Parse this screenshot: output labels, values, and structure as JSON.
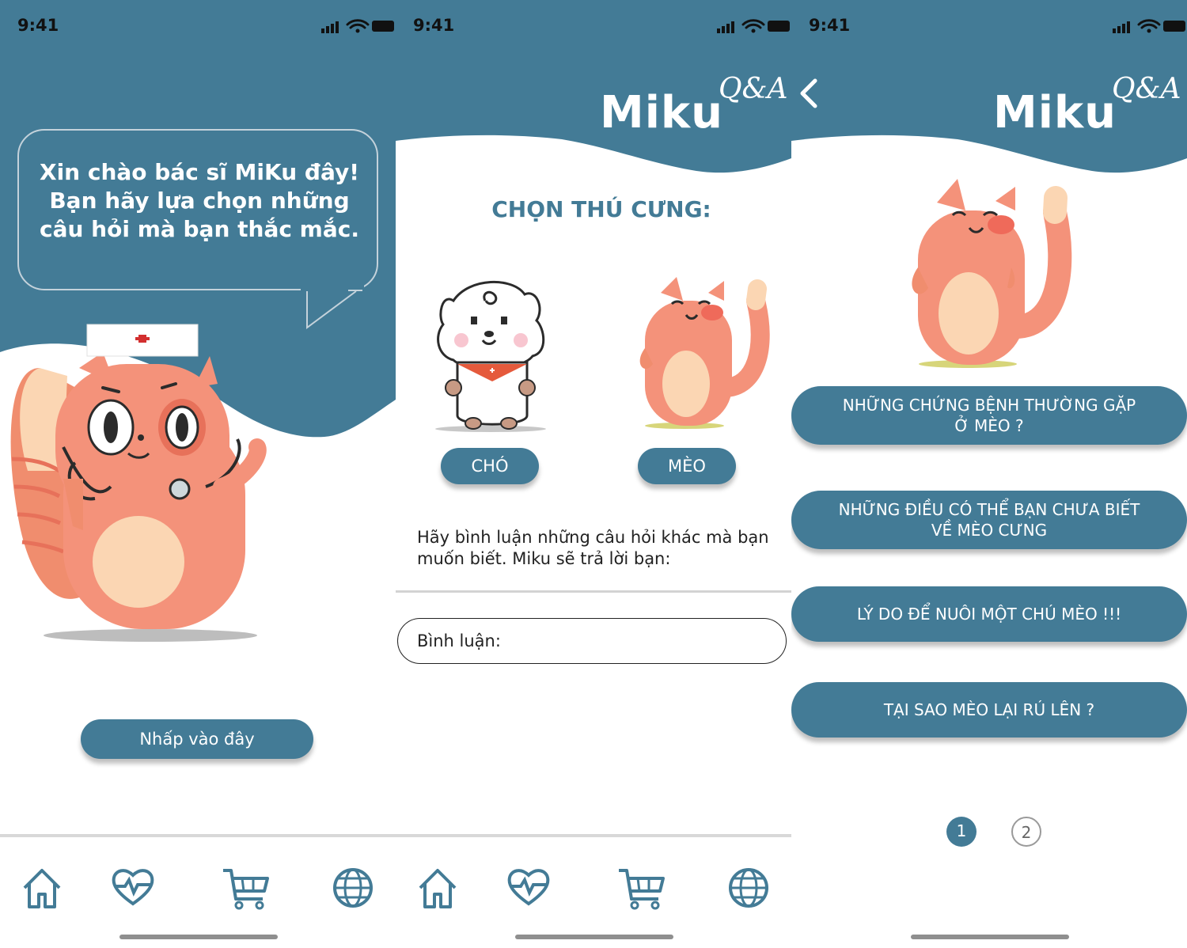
{
  "status_bar": {
    "time": "9:41"
  },
  "colors": {
    "primary": "#437b96",
    "accent_pink": "#f08d6e",
    "background": "#ffffff"
  },
  "screen1": {
    "greeting": "Xin chào bác sĩ MiKu đây! Bạn hãy lựa chọn những câu hỏi mà bạn thắc mắc.",
    "cta_label": "Nhấp vào đây"
  },
  "screen2": {
    "logo_brand": "Miku",
    "logo_qa": "Q&A",
    "heading": "CHỌN THÚ CƯNG:",
    "pet_options": [
      {
        "label": "CHÓ",
        "icon": "dog-mascot"
      },
      {
        "label": "MÈO",
        "icon": "cat-mascot"
      }
    ],
    "comment_prompt": "Hãy bình luận những câu hỏi khác mà bạn muốn biết. Miku sẽ trả lời bạn:",
    "comment_placeholder": "Bình luận:"
  },
  "screen3": {
    "logo_brand": "Miku",
    "logo_qa": "Q&A",
    "questions": [
      "NHỮNG CHỨNG BỆNH THƯỜNG GẶP Ở MÈO ?",
      "NHỮNG ĐIỀU CÓ THỂ BẠN CHƯA BIẾT VỀ MÈO CƯNG",
      "LÝ DO ĐỂ NUÔI MỘT CHÚ MÈO !!!",
      "TẠI SAO MÈO LẠI RÚ LÊN ?"
    ],
    "questions_lines": [
      [
        "NHỮNG CHỨNG BỆNH THƯỜNG GẶP",
        "Ở MÈO ?"
      ],
      [
        "NHỮNG ĐIỀU CÓ THỂ BẠN CHƯA BIẾT",
        "VỀ MÈO CƯNG"
      ]
    ],
    "pages": [
      "1",
      "2"
    ],
    "current_page": "1"
  },
  "tab_bar": [
    {
      "icon": "home-icon"
    },
    {
      "icon": "heart-pulse-icon"
    },
    {
      "icon": "cart-icon"
    },
    {
      "icon": "globe-icon"
    }
  ]
}
